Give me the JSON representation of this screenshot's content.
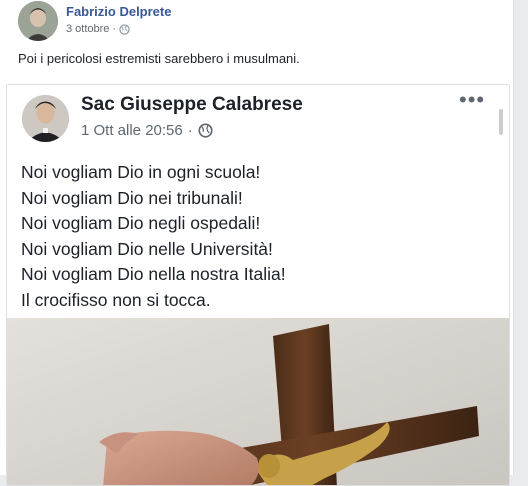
{
  "post": {
    "author": "Fabrizio Delprete",
    "date": "3 ottobre",
    "separator": "·",
    "text": "Poi i pericolosi estremisti sarebbero i musulmani."
  },
  "shared_post": {
    "author": "Sac Giuseppe Calabrese",
    "date": "1 Ott alle 20:56",
    "separator": "·",
    "more": "•••",
    "lines": [
      "Noi vogliam Dio in ogni scuola!",
      "Noi vogliam Dio nei tribunali!",
      "Noi vogliam Dio negli ospedali!",
      "Noi vogliam Dio nelle Università!",
      "Noi vogliam Dio nella nostra Italia!",
      "Il crocifisso non si tocca."
    ]
  },
  "icons": {
    "privacy": "globe-icon",
    "more": "more-options-icon"
  },
  "colors": {
    "author_link": "#385898",
    "text": "#1d2129",
    "meta": "#616770"
  }
}
